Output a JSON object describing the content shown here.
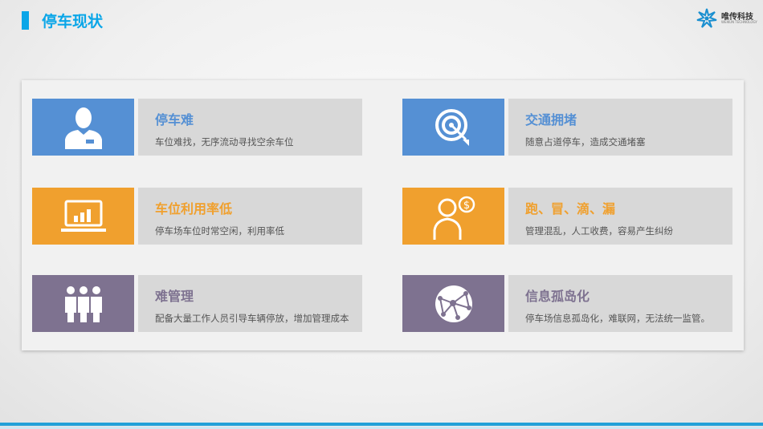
{
  "header": {
    "title": "停车现状"
  },
  "logo": {
    "name": "唯传科技",
    "sub": "WEIKUN TECHNOLOGY"
  },
  "colors": {
    "accent": "#0aa6e8",
    "blue": "#5590d4",
    "orange": "#f0a02e",
    "purple": "#7e7290"
  },
  "items": [
    {
      "title": "停车难",
      "desc": "车位难找，无序流动寻找空余车位",
      "icon": "person-badge-icon"
    },
    {
      "title": "交通拥堵",
      "desc": "随意占道停车，造成交通堵塞",
      "icon": "target-icon"
    },
    {
      "title": "车位利用率低",
      "desc": "停车场车位时常空闲，利用率低",
      "icon": "laptop-chart-icon"
    },
    {
      "title": "跑、冒、滴、漏",
      "desc": "管理混乱，人工收费，容易产生纠纷",
      "icon": "cashier-icon"
    },
    {
      "title": "难管理",
      "desc": "配备大量工作人员引导车辆停放，增加管理成本",
      "icon": "group-icon"
    },
    {
      "title": "信息孤岛化",
      "desc": "停车场信息孤岛化，难联网，无法统一监管。",
      "icon": "network-globe-icon"
    }
  ]
}
